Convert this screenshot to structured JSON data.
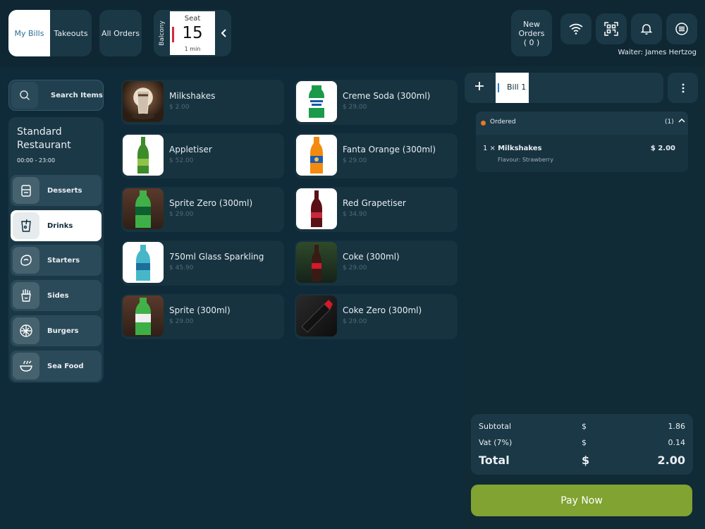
{
  "topbar": {
    "tab_my_bills": "My Bills",
    "tab_takeouts": "Takeouts",
    "all_orders": "All Orders",
    "seat_area": "Balcony",
    "seat_label": "Seat",
    "seat_number": "15",
    "seat_time": "1 min",
    "new_orders_line1": "New",
    "new_orders_line2": "Orders",
    "new_orders_count": "( 0 )",
    "waiter": "Waiter: James Hertzog"
  },
  "sidebar": {
    "search_label": "Search Items",
    "restaurant_line1": "Standard",
    "restaurant_line2": "Restaurant",
    "hours": "00:00 - 23:00",
    "categories": [
      {
        "label": "Desserts",
        "icon": "dessert-icon"
      },
      {
        "label": "Drinks",
        "icon": "drink-icon"
      },
      {
        "label": "Starters",
        "icon": "starter-icon"
      },
      {
        "label": "Sides",
        "icon": "fries-icon"
      },
      {
        "label": "Burgers",
        "icon": "burger-icon"
      },
      {
        "label": "Sea Food",
        "icon": "seafood-icon"
      }
    ]
  },
  "items": [
    {
      "name": "Milkshakes",
      "price": "$ 2.00"
    },
    {
      "name": "Creme Soda (300ml)",
      "price": "$ 29.00"
    },
    {
      "name": "Appletiser",
      "price": "$ 52.00"
    },
    {
      "name": "Fanta Orange (300ml)",
      "price": "$ 29.00"
    },
    {
      "name": "Sprite Zero (300ml)",
      "price": "$ 29.00"
    },
    {
      "name": "Red Grapetiser",
      "price": "$ 34.90"
    },
    {
      "name": "750ml Glass Sparkling",
      "price": "$ 45.90"
    },
    {
      "name": "Coke (300ml)",
      "price": "$ 29.00"
    },
    {
      "name": "Sprite (300ml)",
      "price": "$ 29.00"
    },
    {
      "name": "Coke Zero (300ml)",
      "price": "$ 29.00"
    }
  ],
  "bill": {
    "tab_label": "Bill 1",
    "ordered_label": "Ordered",
    "ordered_count": "(1)",
    "line_qty": "1 ×",
    "line_name": "Milkshakes",
    "line_price": "$ 2.00",
    "line_option": "Flavour: Strawberry",
    "subtotal_label": "Subtotal",
    "subtotal_cur": "$",
    "subtotal_value": "1.86",
    "vat_label": "Vat (7%)",
    "vat_cur": "$",
    "vat_value": "0.14",
    "total_label": "Total",
    "total_cur": "$",
    "total_value": "2.00",
    "pay_label": "Pay Now"
  },
  "colors": {
    "background": "#0f2a38",
    "panel": "#1b3846",
    "accent_green": "#80a331",
    "ordered_dot": "#ea7a22"
  }
}
